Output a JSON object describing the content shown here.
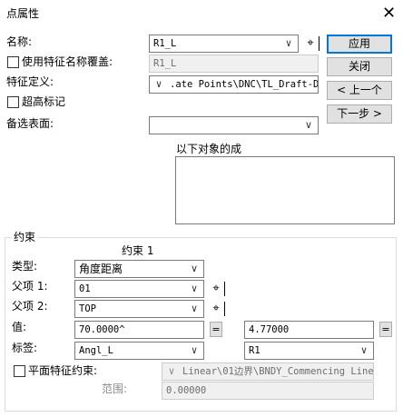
{
  "window": {
    "title": "点属性",
    "close_glyph": "✕"
  },
  "name_label": "名称:",
  "name_value": "R1_L",
  "override_label": "使用特征名称覆盖:",
  "override_value": "R1_L",
  "feature_def_label": "特征定义:",
  "feature_def_value": ".ate Points\\DNC\\TL_Draft-DNC",
  "superelevation_label": "超高标记",
  "alt_surface_label": "备选表面:",
  "alt_surface_value": "",
  "objects_label": "以下对象的成",
  "buttons": {
    "apply": "应用",
    "close": "关闭",
    "prev": "< 上一个",
    "next": "下一步 >"
  },
  "constraints": {
    "group_label": "约束",
    "header": "约束 1",
    "type_label": "类型:",
    "type_value": "角度距离",
    "parent1_label": "父项 1:",
    "parent1_value": "01",
    "parent2_label": "父项 2:",
    "parent2_value": "TOP",
    "value_label": "值:",
    "value1": "70.0000^",
    "value2": "4.77000",
    "eq_label": "=",
    "tag_label": "标签:",
    "tag1": "Angl_L",
    "tag2": "R1",
    "planar_label": "平面特征约束:",
    "planar_value": "Linear\\01边界\\BNDY_Commencing Line",
    "range_label": "范围:",
    "range_value": "0.00000"
  },
  "icons": {
    "chevron": "∨",
    "pick": "⌖"
  }
}
